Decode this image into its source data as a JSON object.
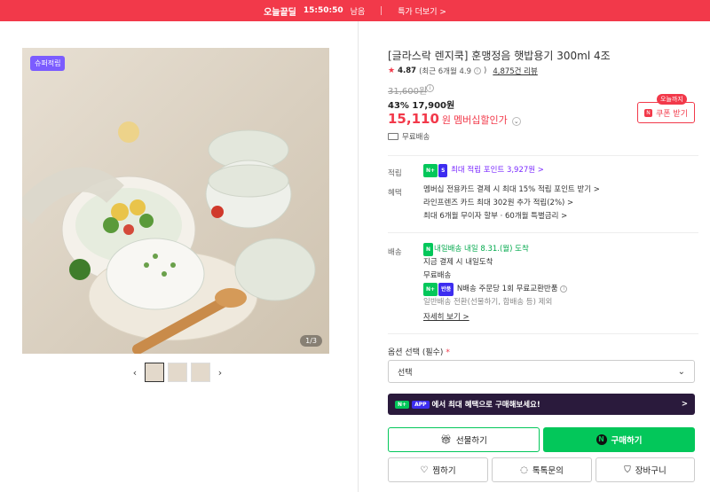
{
  "top_banner": {
    "deal_label": "오늘끝딜",
    "countdown": "15:50:50",
    "remaining_suffix": "남음",
    "more_link": "특가 더보기 >"
  },
  "gallery": {
    "super_badge": "슈퍼적립",
    "counter": "1/3",
    "thumbnail_count": 3,
    "prev_icon": "chevron-left",
    "next_icon": "chevron-right"
  },
  "product": {
    "title": "[글라스락 렌지쿡] 훈맹정음 햇밥용기 300ml 4조",
    "rating": "4.87",
    "rating_recent": "(최근 6개월 4.9",
    "rating_recent_close": ")",
    "review_count": "4,875건 리뷰",
    "original_price": "31,600원",
    "discount_line": "43% 17,900원",
    "member_price": "15,110",
    "member_price_unit": "원",
    "member_label": "멤버십할인가",
    "coupon_tag": "오늘까지",
    "coupon_button": "쿠폰 받기",
    "shipping_free": "무료배송"
  },
  "benefits": {
    "points_label": "적립",
    "points_text": "최대 적립 포인트 3,927원 >",
    "benefit_label": "혜택",
    "benefit_lines": [
      "멤버십 전용카드 결제 시 최대 15% 적립 포인트 받기 >",
      "라인프렌즈 카드 최대 302원 추가 적립(2%) >",
      "최대 6개월 무이자 할부 · 60개월 특별금리 >"
    ],
    "delivery_label": "배송",
    "delivery_badge": "내일배송",
    "delivery_date": "내일 8.31.(월) 도착",
    "delivery_lines": [
      "지금 결제 시 내일도착",
      "무료배송"
    ],
    "return_text": "N배송 주문당 1회 무료교환반품",
    "exclusion_text": "일반배송 전환(선물하기, 합배송 등) 제외",
    "detail_link": "자세히 보기 >"
  },
  "options": {
    "label": "옵션 선택 (필수)",
    "required_mark": "*",
    "select_value": "선택"
  },
  "promo": {
    "app_badge": "APP",
    "text": "에서 최대 혜택으로 구매해보세요!",
    "arrow": ">"
  },
  "buttons": {
    "gift": "선물하기",
    "buy": "구매하기",
    "wish": "찜하기",
    "talk": "톡톡문의",
    "cart": "장바구니"
  },
  "colors": {
    "accent_red": "#f2394a",
    "naver_green": "#03c75a",
    "promo_dark": "#2a1a3c",
    "plus_purple": "#7b2bff"
  }
}
